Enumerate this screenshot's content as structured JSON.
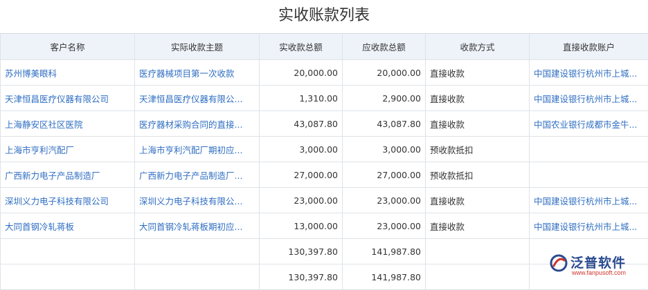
{
  "title": "实收账款列表",
  "columns": [
    "客户名称",
    "实际收款主题",
    "实收款总额",
    "应收款总额",
    "收款方式",
    "直接收款账户"
  ],
  "rows": [
    {
      "customer": "苏州博美眼科",
      "subject": "医疗器械项目第一次收款",
      "received": "20,000.00",
      "receivable": "20,000.00",
      "method": "直接收款",
      "account": "中国建设银行杭州市上城..."
    },
    {
      "customer": "天津恒昌医疗仪器有限公司",
      "subject": "天津恒昌医疗仪器有限公...",
      "received": "1,310.00",
      "receivable": "2,900.00",
      "method": "直接收款",
      "account": "中国建设银行杭州市上城..."
    },
    {
      "customer": "上海静安区社区医院",
      "subject": "医疗器材采购合同的直接...",
      "received": "43,087.80",
      "receivable": "43,087.80",
      "method": "直接收款",
      "account": "中国农业银行成都市金牛..."
    },
    {
      "customer": "上海市亨利汽配厂",
      "subject": "上海市亨利汽配厂期初应...",
      "received": "3,000.00",
      "receivable": "3,000.00",
      "method": "预收款抵扣",
      "account": ""
    },
    {
      "customer": "广西新力电子产品制造厂",
      "subject": "广西新力电子产品制造厂...",
      "received": "27,000.00",
      "receivable": "27,000.00",
      "method": "预收款抵扣",
      "account": ""
    },
    {
      "customer": "深圳义力电子科技有限公司",
      "subject": "深圳义力电子科技有限公...",
      "received": "23,000.00",
      "receivable": "23,000.00",
      "method": "直接收款",
      "account": "中国建设银行杭州市上城..."
    },
    {
      "customer": "大同首钢冷轧蒋板",
      "subject": "大同首钢冷轧蒋板期初应...",
      "received": "13,000.00",
      "receivable": "23,000.00",
      "method": "直接收款",
      "account": "中国建设银行杭州市上城..."
    }
  ],
  "totals": [
    {
      "received": "130,397.80",
      "receivable": "141,987.80"
    },
    {
      "received": "130,397.80",
      "receivable": "141,987.80"
    }
  ],
  "logo": {
    "name": "泛普软件",
    "url": "www.fanpusoft.com"
  },
  "colors": {
    "link": "#2f6ec2",
    "header_bg": "#eef3fa",
    "border": "#dfe3e8",
    "logo_blue": "#2a4a8f",
    "logo_red": "#d0342c"
  }
}
